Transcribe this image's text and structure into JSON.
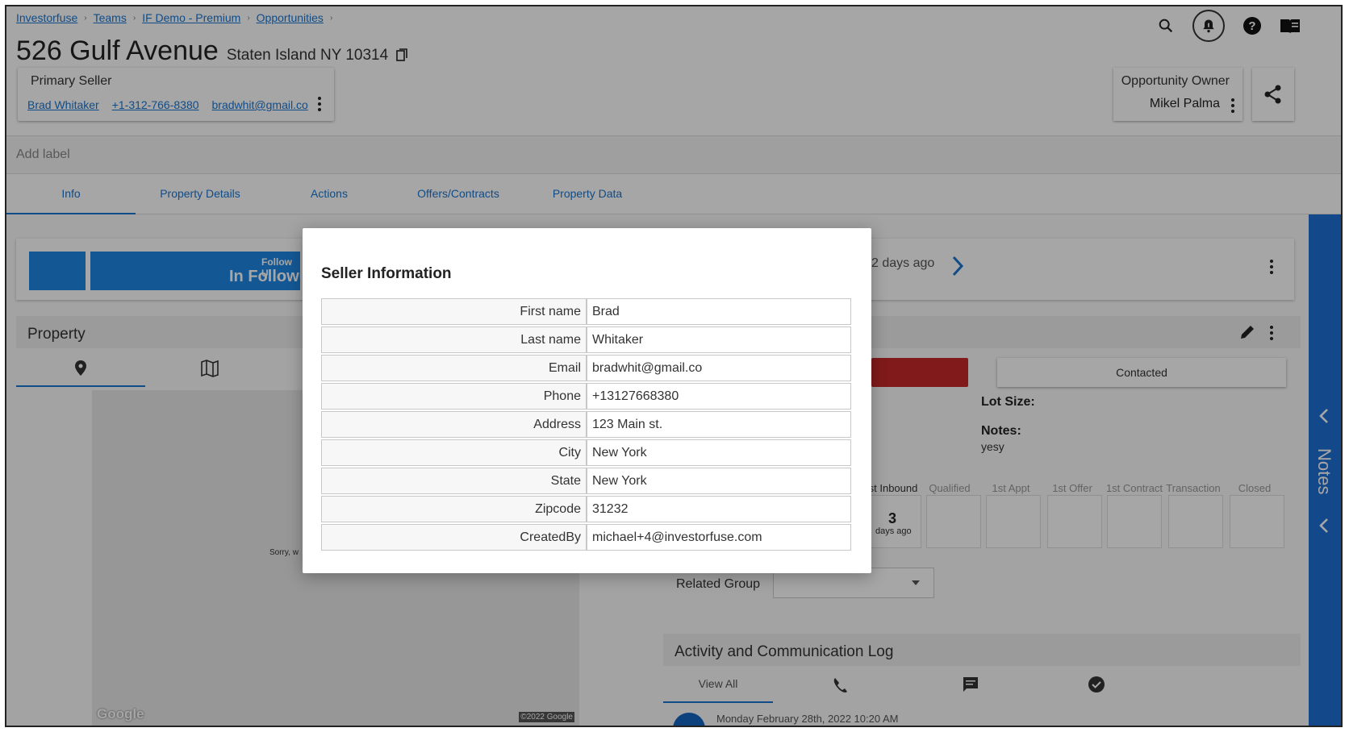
{
  "breadcrumb": [
    "Investorfuse",
    "Teams",
    "IF Demo - Premium",
    "Opportunities"
  ],
  "property": {
    "street": "526 Gulf Avenue",
    "city_state_zip": "Staten Island NY 10314"
  },
  "primary_seller": {
    "label": "Primary Seller",
    "name": "Brad Whitaker",
    "phone": "+1-312-766-8380",
    "email": "bradwhit@gmail.co"
  },
  "owner": {
    "label": "Opportunity Owner",
    "name": "Mikel Palma"
  },
  "add_label": "Add label",
  "tabs": [
    {
      "label": "Info",
      "active": true
    },
    {
      "label": "Property Details"
    },
    {
      "label": "Actions"
    },
    {
      "label": "Offers/Contracts"
    },
    {
      "label": "Property Data"
    }
  ],
  "pipeline": {
    "stage_small": "Follow U",
    "stage_big": "In Followu",
    "time_ago": "2 days ago"
  },
  "property_section": {
    "title": "Property"
  },
  "status_button": "Contacted",
  "lot_size_label": "Lot Size:",
  "notes_label": "Notes:",
  "notes_value": "yesy",
  "stages": [
    "st Inbound",
    "Qualified",
    "1st Appt",
    "1st Offer",
    "1st Contract",
    "Transaction",
    "Closed"
  ],
  "inbound_count": "3",
  "inbound_sub": "days ago",
  "related_group_label": "Related Group",
  "activity": {
    "title": "Activity and Communication Log",
    "view_all": "View All",
    "entry_date": "Monday February 28th, 2022 10:20 AM"
  },
  "map": {
    "sorry": "Sorry, w",
    "copyright": "©2022 Google",
    "logo": "Google"
  },
  "notes_rail": "Notes",
  "modal": {
    "title": "Seller Information",
    "rows": [
      {
        "k": "First name",
        "v": "Brad"
      },
      {
        "k": "Last name",
        "v": "Whitaker"
      },
      {
        "k": "Email",
        "v": "bradwhit@gmail.co"
      },
      {
        "k": "Phone",
        "v": "+13127668380"
      },
      {
        "k": "Address",
        "v": "123 Main st."
      },
      {
        "k": "City",
        "v": "New York"
      },
      {
        "k": "State",
        "v": "New York"
      },
      {
        "k": "Zipcode",
        "v": "31232"
      },
      {
        "k": "CreatedBy",
        "v": "michael+4@investorfuse.com"
      }
    ]
  },
  "colors": {
    "accent": "#1976d2",
    "notes_rail": "#1e6fd6",
    "danger": "#c62828"
  }
}
